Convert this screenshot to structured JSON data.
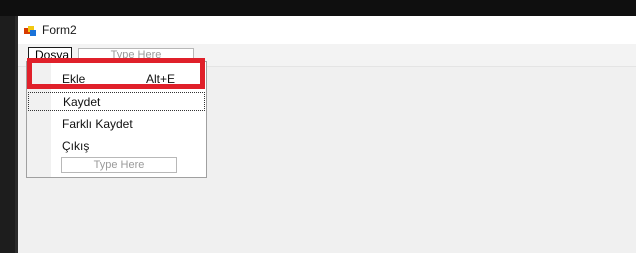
{
  "window": {
    "title": "Form2"
  },
  "menubar": {
    "dosya_label": "Dosya",
    "type_here_label": "Type Here"
  },
  "dropdown": {
    "items": [
      {
        "label": "Ekle",
        "shortcut": "Alt+E"
      },
      {
        "label": "Kaydet",
        "shortcut": ""
      },
      {
        "label": "Farklı Kaydet",
        "shortcut": ""
      },
      {
        "label": "Çıkış",
        "shortcut": ""
      }
    ],
    "type_here_label": "Type Here"
  },
  "colors": {
    "highlight": "#e0202a",
    "titlebar_bg": "#ffffff",
    "client_bg": "#f0f0f0"
  },
  "icons": {
    "app": "winforms-form-icon"
  }
}
